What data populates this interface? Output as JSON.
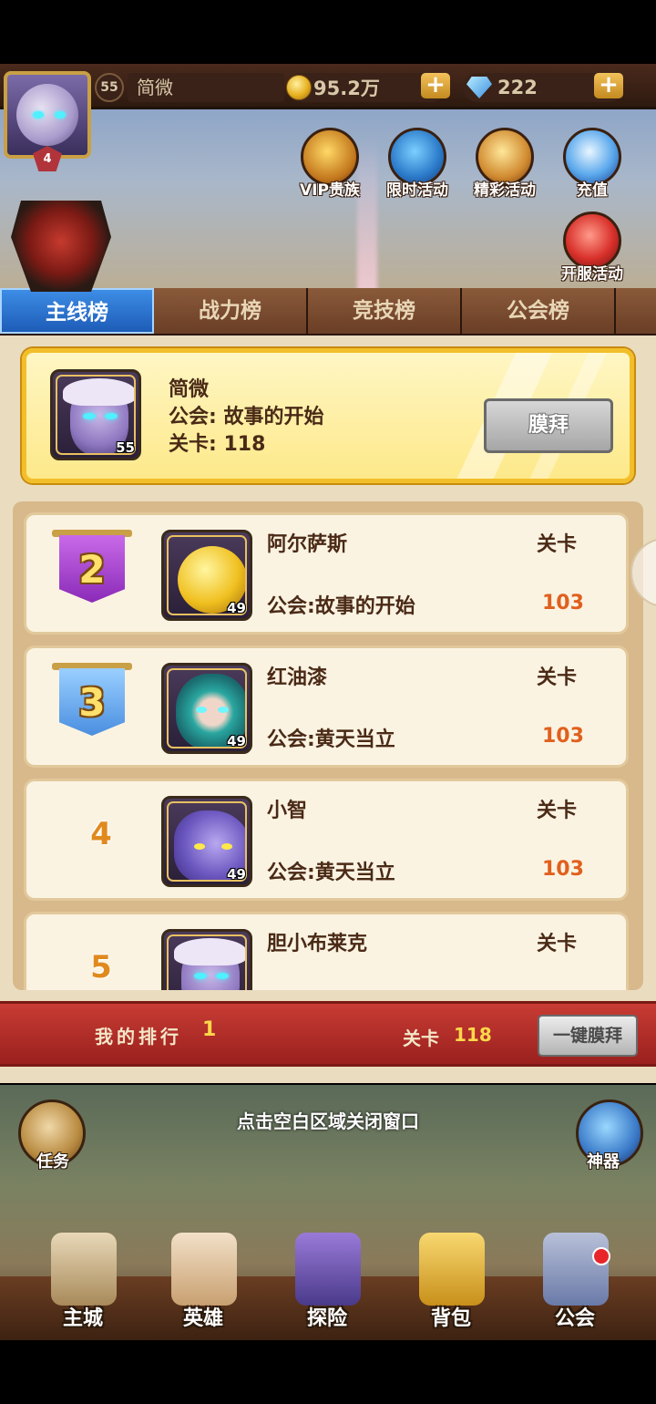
{
  "player": {
    "level": "55",
    "name": "简微",
    "vip_level": "4",
    "gold": "95.2万",
    "diamonds": "222"
  },
  "activities": [
    {
      "label": "VIP贵族",
      "icon": "crown-icon"
    },
    {
      "label": "限时活动",
      "icon": "compass-icon"
    },
    {
      "label": "精彩活动",
      "icon": "scroll-icon"
    },
    {
      "label": "充值",
      "icon": "gem-icon"
    },
    {
      "label": "开服活动",
      "icon": "gift-icon"
    }
  ],
  "tabs": [
    "主线榜",
    "战力榜",
    "竞技榜",
    "公会榜"
  ],
  "active_tab": "主线榜",
  "top_player": {
    "name": "简微",
    "guild": "公会: 故事的开始",
    "stage": "关卡: 118",
    "level": "55",
    "worship_label": "膜拜"
  },
  "ranking": [
    {
      "rank": "2",
      "name": "阿尔萨斯",
      "level": "49",
      "guild": "公会:故事的开始",
      "stage_label": "关卡",
      "stage": "103",
      "badge": "purple"
    },
    {
      "rank": "3",
      "name": "红油漆",
      "level": "49",
      "guild": "公会:黄天当立",
      "stage_label": "关卡",
      "stage": "103",
      "badge": "blue"
    },
    {
      "rank": "4",
      "name": "小智",
      "level": "49",
      "guild": "公会:黄天当立",
      "stage_label": "关卡",
      "stage": "103",
      "badge": "none"
    },
    {
      "rank": "5",
      "name": "胆小布莱克",
      "level": "",
      "guild": "",
      "stage_label": "关卡",
      "stage": "",
      "badge": "none"
    }
  ],
  "my_rank": {
    "label": "我的排行",
    "rank": "1",
    "stage_label": "关卡",
    "stage": "118",
    "worship_all_label": "一键膜拜"
  },
  "close_hint": "点击空白区域关闭窗口",
  "side_buttons": {
    "left": "任务",
    "right": "神器"
  },
  "nav": [
    "主城",
    "英雄",
    "探险",
    "背包",
    "公会"
  ],
  "colors": {
    "tab_active": "#1d5cb8",
    "card_highlight": "#f2bf2a",
    "stage_value": "#e0601e",
    "my_bar": "#b02a26"
  }
}
